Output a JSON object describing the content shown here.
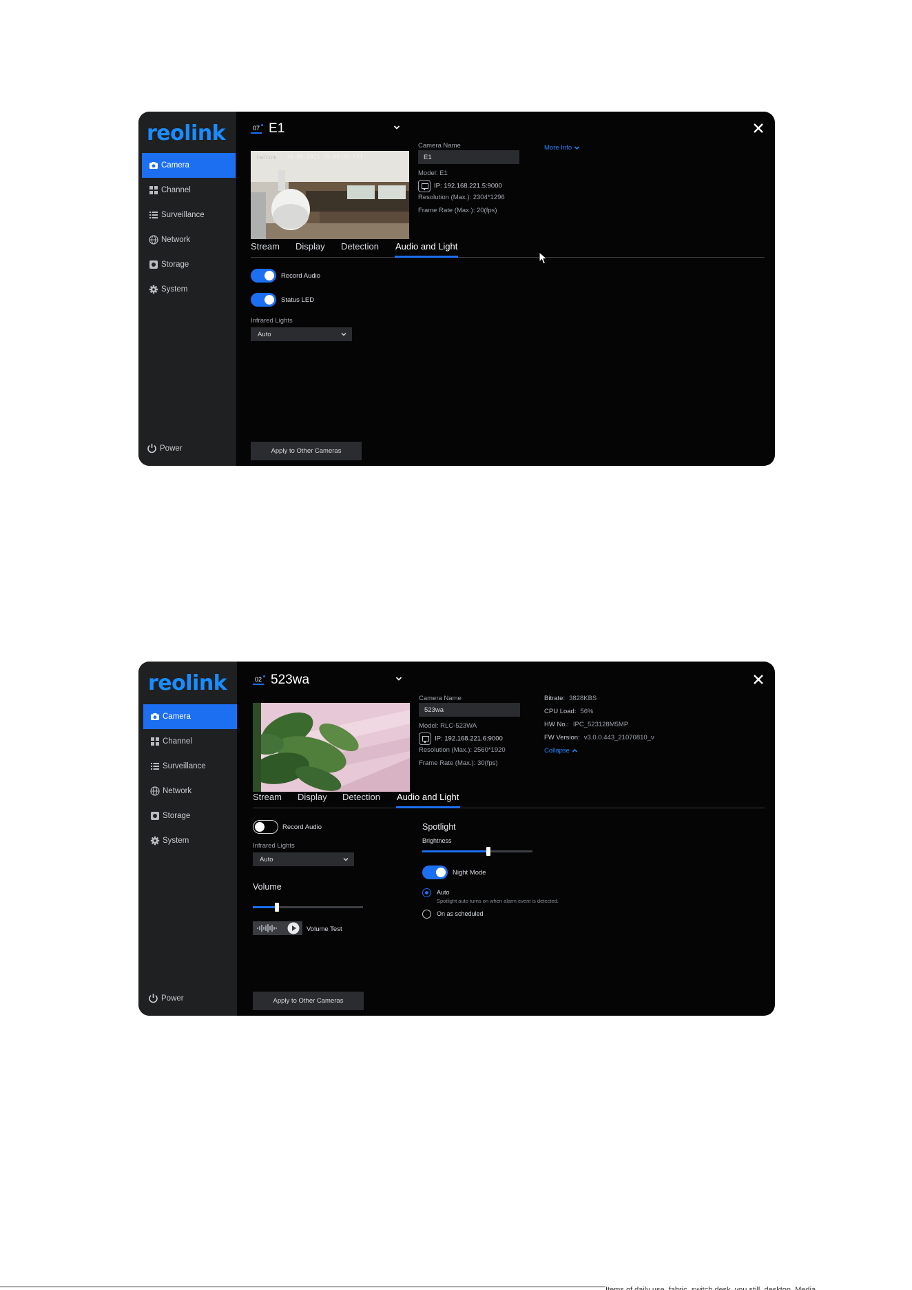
{
  "window1": {
    "logo": "reolink",
    "nav": [
      {
        "label": "Camera",
        "icon": "camera-icon"
      },
      {
        "label": "Channel",
        "icon": "channel-grid-icon"
      },
      {
        "label": "Surveillance",
        "icon": "list-icon"
      },
      {
        "label": "Network",
        "icon": "globe-icon"
      },
      {
        "label": "Storage",
        "icon": "storage-icon"
      },
      {
        "label": "System",
        "icon": "gear-icon"
      }
    ],
    "power_label": "Power",
    "channel_number": "07",
    "camera_title": "E1",
    "osd_timestamp": "10-09-2021 20:00:26 FRI",
    "osd_brand": "reolink",
    "camera_name_label": "Camera Name",
    "camera_name_value": "E1",
    "model": "Model:  E1",
    "ip": "IP:   192.168.221.5:9000",
    "resolution": "Resolution (Max.):   2304*1296",
    "frame_rate": "Frame Rate (Max.):    20(fps)",
    "more_info": "More Info",
    "tabs": [
      "Stream",
      "Display",
      "Detection",
      "Audio and Light"
    ],
    "active_tab": "Audio and Light",
    "record_audio": {
      "label": "Record Audio",
      "on": true
    },
    "status_led": {
      "label": "Status LED",
      "on": true
    },
    "infrared_label": "Infrared Lights",
    "infrared_value": "Auto",
    "apply_label": "Apply to Other Cameras"
  },
  "window2": {
    "logo": "reolink",
    "nav": [
      {
        "label": "Camera",
        "icon": "camera-icon"
      },
      {
        "label": "Channel",
        "icon": "channel-grid-icon"
      },
      {
        "label": "Surveillance",
        "icon": "list-icon"
      },
      {
        "label": "Network",
        "icon": "globe-icon"
      },
      {
        "label": "Storage",
        "icon": "storage-icon"
      },
      {
        "label": "System",
        "icon": "gear-icon"
      }
    ],
    "power_label": "Power",
    "channel_number": "02",
    "camera_title": "523wa",
    "camera_name_label": "Camera Name",
    "camera_name_value": "523wa",
    "model": "Model:  RLC-523WA",
    "ip": "IP:   192.168.221.6:9000",
    "resolution": "Resolution (Max.):   2560*1920",
    "frame_rate": "Frame Rate (Max.):    30(fps)",
    "bitrate_label": "Bitrate:",
    "bitrate_value": "3828KBS",
    "cpu_label": "CPU Load:",
    "cpu_value": "56%",
    "hw_label": "HW No.:",
    "hw_value": "IPC_523128M5MP",
    "fw_label": "FW Version:",
    "fw_value": "v3.0.0.443_21070810_v",
    "collapse": "Collapse",
    "tabs": [
      "Stream",
      "Display",
      "Detection",
      "Audio and Light"
    ],
    "active_tab": "Audio and Light",
    "record_audio": {
      "label": "Record Audio",
      "on": false
    },
    "infrared_label": "Infrared Lights",
    "infrared_value": "Auto",
    "volume_title": "Volume",
    "volume_level": 0.22,
    "volume_test_label": "Volume Test",
    "spotlight_title": "Spotlight",
    "brightness_label": "Brightness",
    "brightness_level": 0.6,
    "night_mode": {
      "label": "Night Mode",
      "on": true
    },
    "radio_auto_label": "Auto",
    "radio_auto_hint": "Spotlight auto turns on when alarm event is detected.",
    "radio_scheduled_label": "On as scheduled",
    "selected_mode": "Auto",
    "apply_label": "Apply to Other Cameras"
  },
  "footer_fragment": "Items of daily use, fabric, switch desk, you still, desktop, Media",
  "colors": {
    "accent": "#1d6ff2",
    "link": "#1d86ff",
    "sidebar": "#1f2022",
    "panel": "#050506"
  }
}
